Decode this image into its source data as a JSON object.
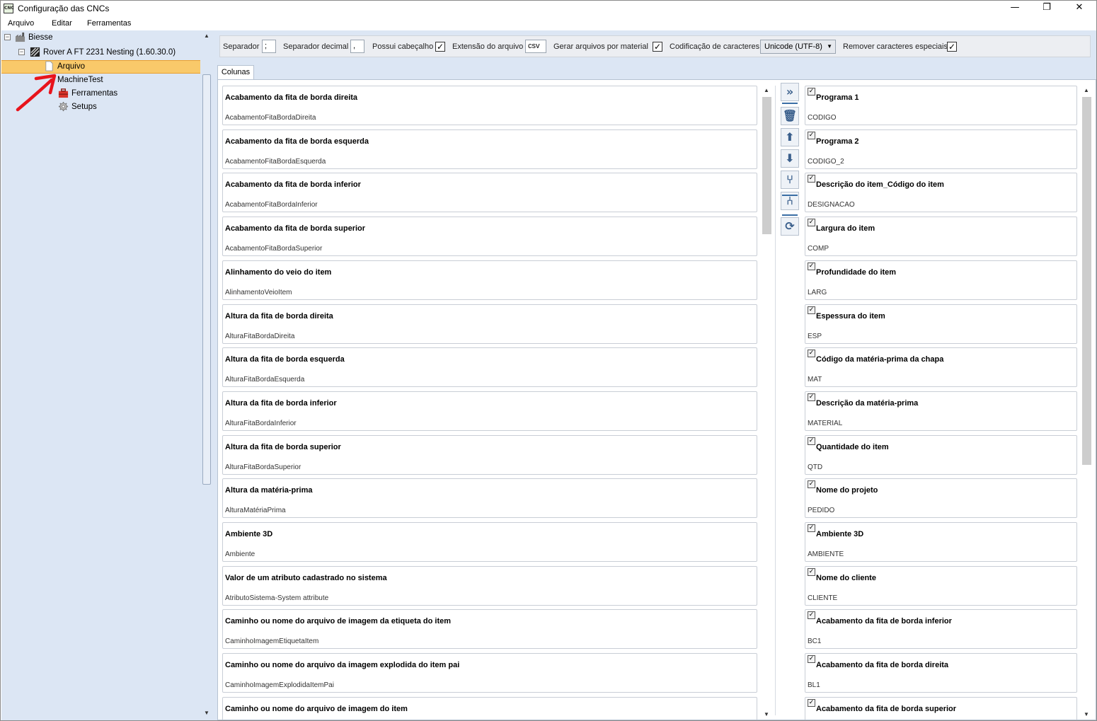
{
  "window": {
    "title": "Configuração das CNCs",
    "app_icon_text": "CNC",
    "minimize": "—",
    "restore": "❐",
    "close": "✕"
  },
  "menu": [
    "Arquivo",
    "Editar",
    "Ferramentas"
  ],
  "tree": {
    "root": "Biesse",
    "machine": "Rover A FT 2231 Nesting (1.60.30.0)",
    "items": [
      "Arquivo",
      "MachineTest",
      "Ferramentas",
      "Setups"
    ],
    "selected": "Arquivo"
  },
  "options": {
    "separator_label": "Separador",
    "separator_value": ";",
    "decimal_label": "Separador decimal",
    "decimal_value": ",",
    "header_label": "Possui cabeçalho",
    "header_checked": true,
    "extension_label": "Extensão do arquivo",
    "extension_value": "csv",
    "per_material_label": "Gerar arquivos por material",
    "per_material_checked": true,
    "encoding_label": "Codificação de caracteres",
    "encoding_value": "Unicode (UTF-8)",
    "remove_special_label": "Remover caracteres especiais",
    "remove_special_checked": true
  },
  "tab": "Colunas",
  "available_columns": [
    {
      "title": "Acabamento da fita de borda direita",
      "field": "AcabamentoFitaBordaDireita"
    },
    {
      "title": "Acabamento da fita de borda esquerda",
      "field": "AcabamentoFitaBordaEsquerda"
    },
    {
      "title": "Acabamento da fita de borda inferior",
      "field": "AcabamentoFitaBordaInferior"
    },
    {
      "title": "Acabamento da fita de borda superior",
      "field": "AcabamentoFitaBordaSuperior"
    },
    {
      "title": "Alinhamento do veio do item",
      "field": "AlinhamentoVeioItem"
    },
    {
      "title": "Altura da fita de borda direita",
      "field": "AlturaFitaBordaDireita"
    },
    {
      "title": "Altura da fita de borda esquerda",
      "field": "AlturaFitaBordaEsquerda"
    },
    {
      "title": "Altura da fita de borda inferior",
      "field": "AlturaFitaBordaInferior"
    },
    {
      "title": "Altura da fita de borda superior",
      "field": "AlturaFitaBordaSuperior"
    },
    {
      "title": "Altura da matéria-prima",
      "field": "AlturaMatériaPrima"
    },
    {
      "title": "Ambiente 3D",
      "field": "Ambiente"
    },
    {
      "title": "Valor de um atributo cadastrado no sistema",
      "field": "AtributoSistema-System attribute"
    },
    {
      "title": "Caminho ou nome do arquivo de imagem da etiqueta do item",
      "field": "CaminhoImagemEtiquetaItem"
    },
    {
      "title": "Caminho ou nome do arquivo da imagem explodida do item pai",
      "field": "CaminhoImagemExplodidaItemPai"
    },
    {
      "title": "Caminho ou nome do arquivo de imagem do item",
      "field": ""
    }
  ],
  "selected_columns": [
    {
      "title": "Programa 1",
      "field": "CODIGO"
    },
    {
      "title": "Programa 2",
      "field": "CODIGO_2"
    },
    {
      "title": "Descrição do item_Código do item",
      "field": "DESIGNACAO"
    },
    {
      "title": "Largura do item",
      "field": "COMP"
    },
    {
      "title": "Profundidade do item",
      "field": "LARG"
    },
    {
      "title": "Espessura do item",
      "field": "ESP"
    },
    {
      "title": "Código da matéria-prima da chapa",
      "field": "MAT"
    },
    {
      "title": "Descrição da matéria-prima",
      "field": "MATERIAL"
    },
    {
      "title": "Quantidade do item",
      "field": "QTD"
    },
    {
      "title": "Nome do projeto",
      "field": "PEDIDO"
    },
    {
      "title": "Ambiente 3D",
      "field": "AMBIENTE"
    },
    {
      "title": "Nome do cliente",
      "field": "CLIENTE"
    },
    {
      "title": "Acabamento da fita de borda inferior",
      "field": "BC1"
    },
    {
      "title": "Acabamento da fita de borda direita",
      "field": "BL1"
    },
    {
      "title": "Acabamento da fita de borda superior",
      "field": ""
    }
  ],
  "actions": [
    {
      "name": "add-column-icon",
      "glyph": "»"
    },
    {
      "name": "delete-icon",
      "glyph": "🗑"
    },
    {
      "name": "move-up-icon",
      "glyph": "⬆"
    },
    {
      "name": "move-down-icon",
      "glyph": "⬇"
    },
    {
      "name": "merge-icon",
      "glyph": "⑂"
    },
    {
      "name": "split-icon",
      "glyph": "⑃"
    },
    {
      "name": "refresh-icon",
      "glyph": "⟳"
    }
  ],
  "colors": {
    "tree_bg": "#dce6f4",
    "selection": "#f9c96a",
    "annotation_arrow": "#e8141c"
  }
}
